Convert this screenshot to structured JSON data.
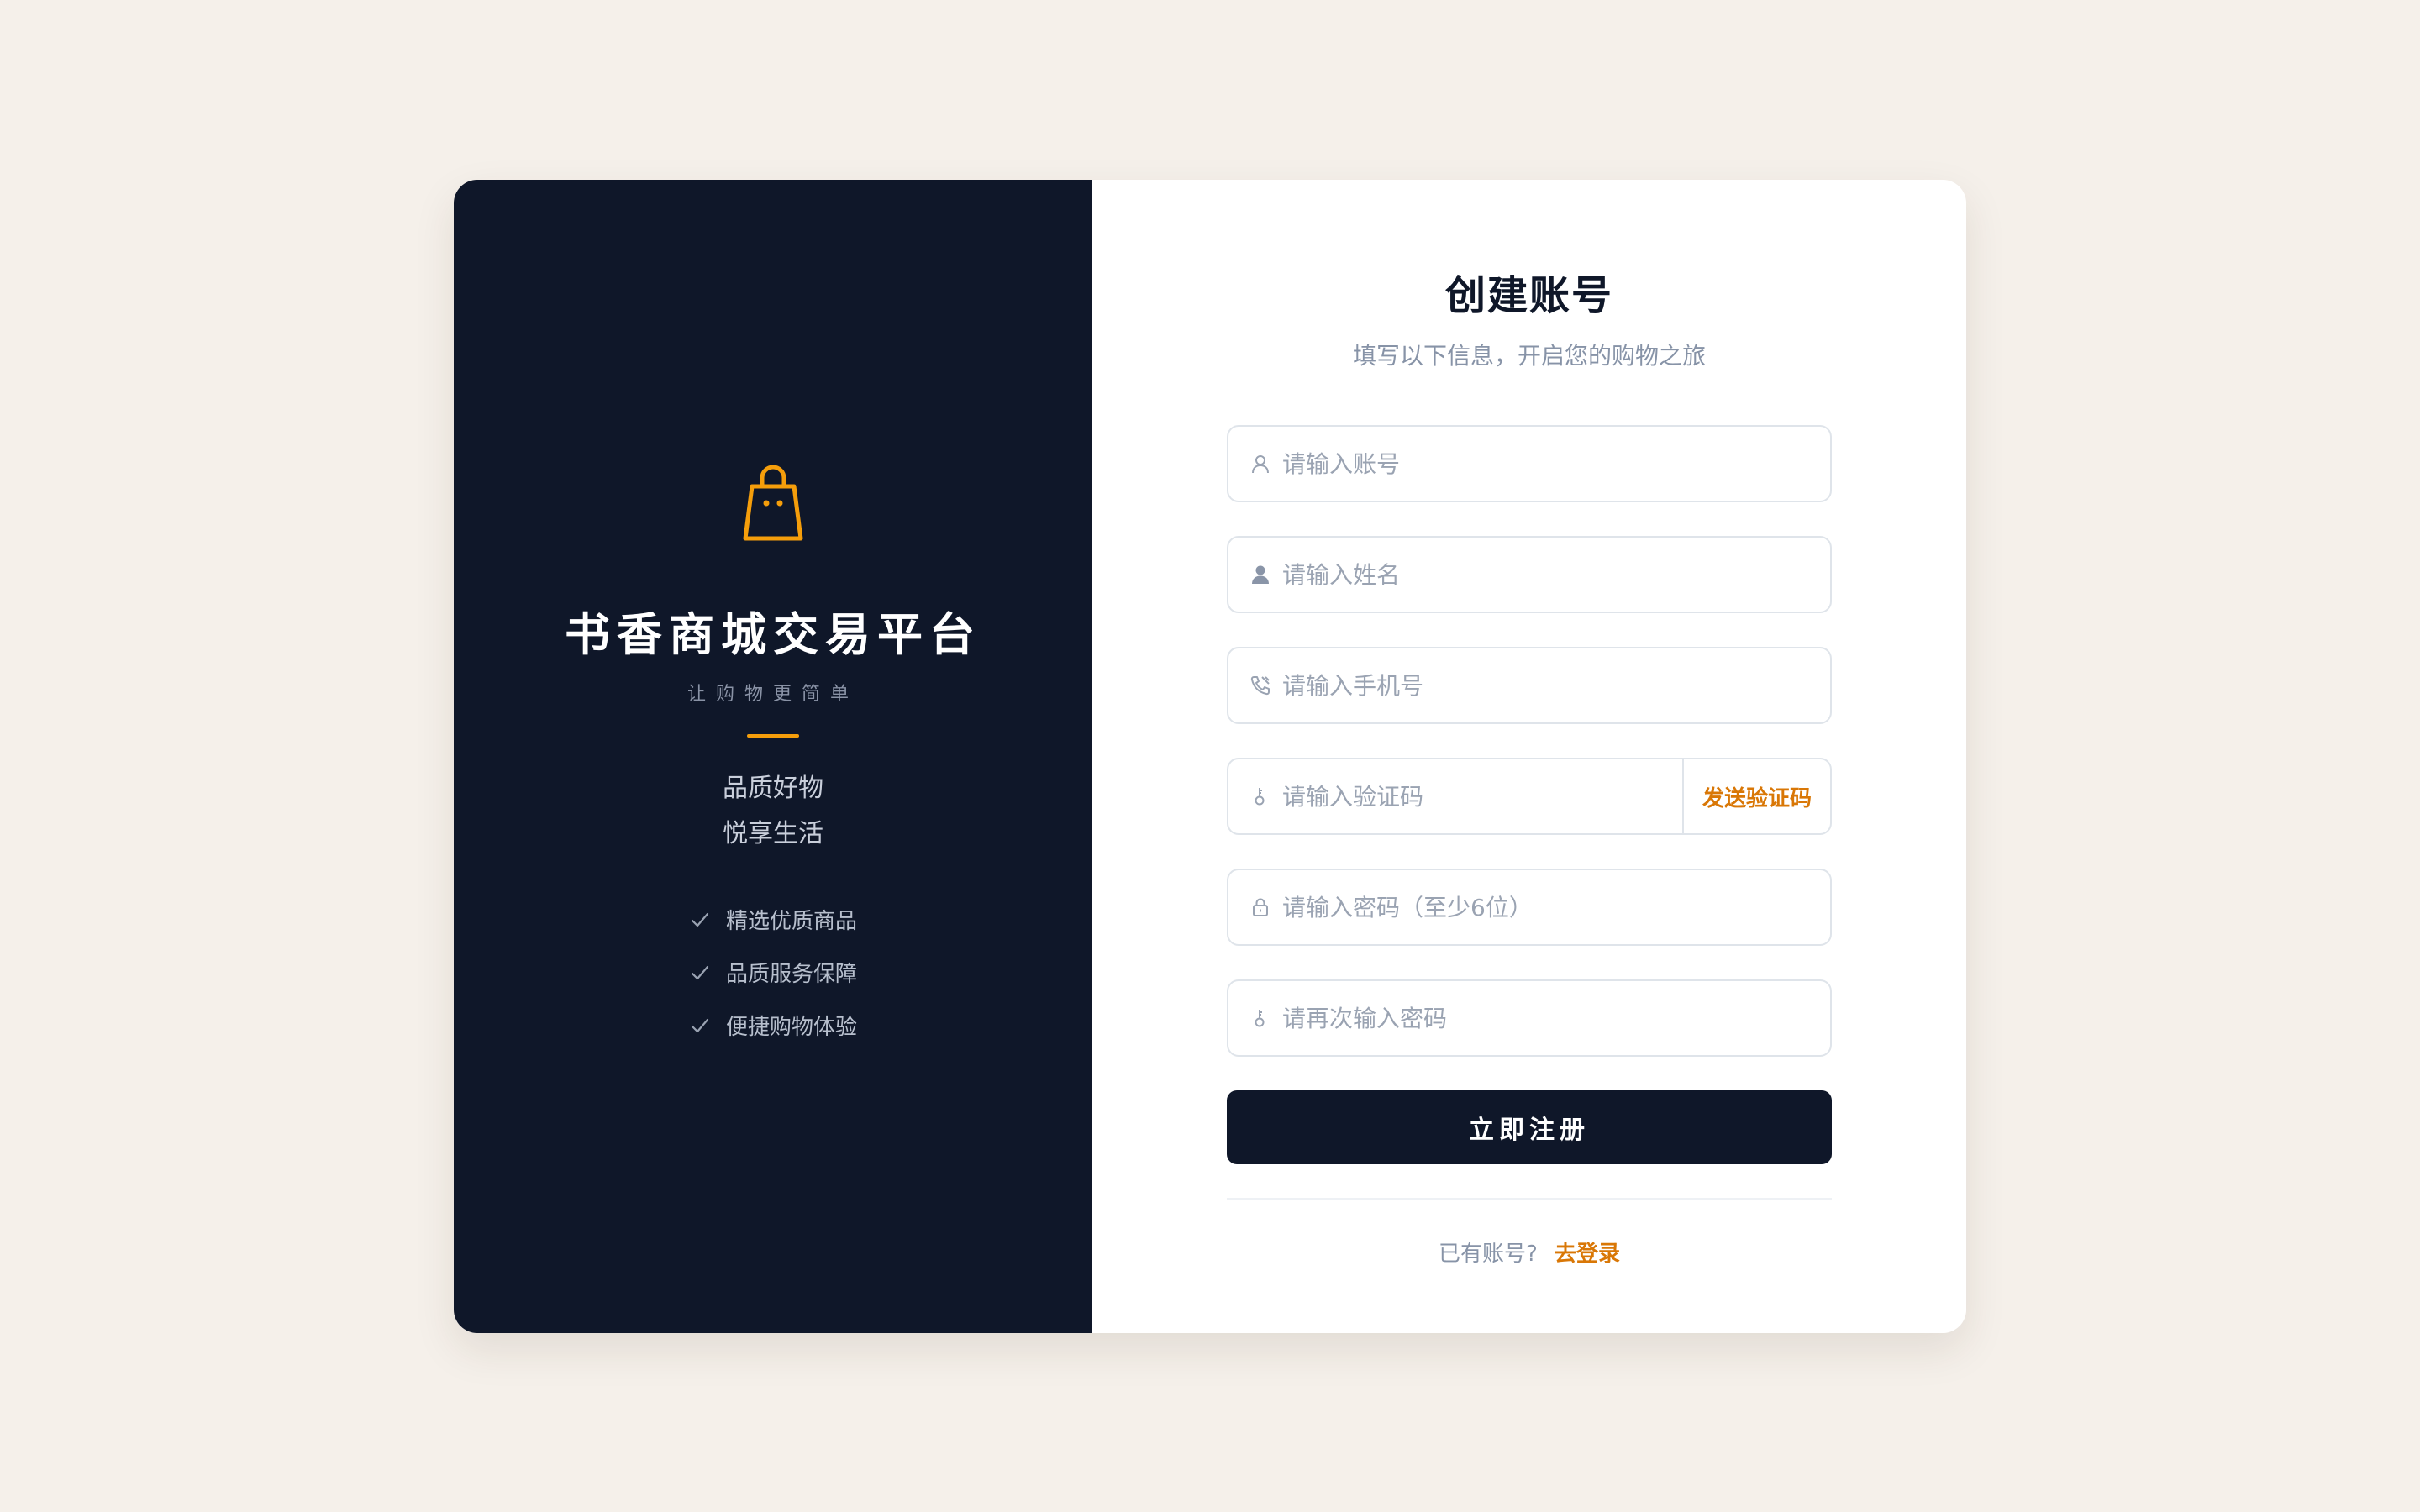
{
  "brand": {
    "title": "书香商城交易平台",
    "subtitle": "让购物更简单",
    "slogan_line1": "品质好物",
    "slogan_line2": "悦享生活",
    "features": [
      "精选优质商品",
      "品质服务保障",
      "便捷购物体验"
    ],
    "icon": "shopping-bag-icon"
  },
  "form": {
    "title": "创建账号",
    "subtitle": "填写以下信息，开启您的购物之旅",
    "fields": {
      "account": {
        "placeholder": "请输入账号",
        "value": "",
        "icon": "user-outline-icon"
      },
      "name": {
        "placeholder": "请输入姓名",
        "value": "",
        "icon": "user-filled-icon"
      },
      "phone": {
        "placeholder": "请输入手机号",
        "value": "",
        "icon": "phone-icon"
      },
      "code": {
        "placeholder": "请输入验证码",
        "value": "",
        "icon": "key-icon"
      },
      "password": {
        "placeholder": "请输入密码（至少6位）",
        "value": "",
        "icon": "lock-icon"
      },
      "confirm": {
        "placeholder": "请再次输入密码",
        "value": "",
        "icon": "key-icon"
      }
    },
    "send_code_label": "发送验证码",
    "submit_label": "立即注册",
    "login_prompt": "已有账号?",
    "login_link": "去登录"
  },
  "colors": {
    "background": "#f5f0ea",
    "panel_dark": "#0f1729",
    "accent": "#f59e0b",
    "link": "#d97706"
  }
}
